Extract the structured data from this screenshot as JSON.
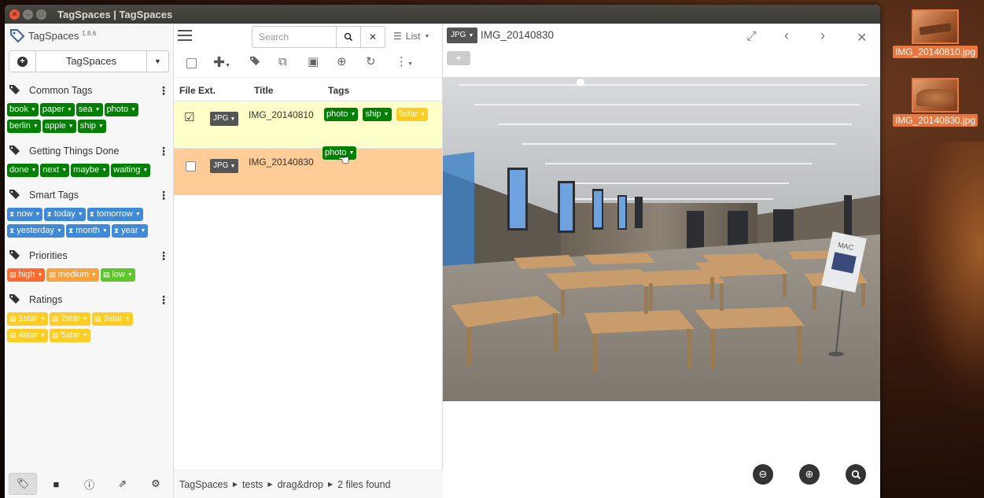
{
  "window": {
    "title": "TagSpaces | TagSpaces"
  },
  "app": {
    "name": "TagSpaces",
    "version": "1.8.6",
    "location": "TagSpaces"
  },
  "tag_groups": [
    {
      "name": "Common Tags",
      "tags": [
        {
          "label": "book"
        },
        {
          "label": "paper"
        },
        {
          "label": "sea"
        },
        {
          "label": "photo"
        },
        {
          "label": "berlin"
        },
        {
          "label": "apple"
        },
        {
          "label": "ship"
        }
      ]
    },
    {
      "name": "Getting Things Done",
      "tags": [
        {
          "label": "done"
        },
        {
          "label": "next"
        },
        {
          "label": "maybe"
        },
        {
          "label": "waiting"
        }
      ]
    },
    {
      "name": "Smart Tags",
      "tags": [
        {
          "label": "now"
        },
        {
          "label": "today"
        },
        {
          "label": "tomorrow"
        },
        {
          "label": "yesterday"
        },
        {
          "label": "month"
        },
        {
          "label": "year"
        }
      ]
    },
    {
      "name": "Priorities",
      "tags": [
        {
          "label": "high"
        },
        {
          "label": "medium"
        },
        {
          "label": "low"
        }
      ]
    },
    {
      "name": "Ratings",
      "tags": [
        {
          "label": "1star"
        },
        {
          "label": "2star"
        },
        {
          "label": "3star"
        },
        {
          "label": "4star"
        },
        {
          "label": "5star"
        }
      ]
    }
  ],
  "search": {
    "placeholder": "Search"
  },
  "view_mode": "List",
  "columns": {
    "ext": "File Ext.",
    "title": "Title",
    "tags": "Tags"
  },
  "files": [
    {
      "ext": "JPG",
      "title": "IMG_20140810",
      "selected": true,
      "tags": [
        {
          "label": "photo"
        },
        {
          "label": "ship"
        },
        {
          "label": "5star"
        }
      ]
    },
    {
      "ext": "JPG",
      "title": "IMG_20140830",
      "selected": false,
      "tags": []
    }
  ],
  "dragging_tag": "photo",
  "breadcrumb": {
    "root": "TagSpaces",
    "folder1": "tests",
    "folder2": "drag&drop",
    "count": "2 files found"
  },
  "viewer": {
    "ext": "JPG",
    "title": "IMG_20140830"
  },
  "desktop": [
    {
      "label": "IMG_20140810.jpg"
    },
    {
      "label": "IMG_20140830.jpg"
    }
  ],
  "colors": {
    "green": "#008000",
    "blue": "#3f8ad8",
    "high": "#ff6a30",
    "medium": "#f7a13f",
    "low": "#5ec52b",
    "rating": "#ffcc24",
    "selected_row": "#ffffc9",
    "hover_row": "#ffcb96"
  }
}
